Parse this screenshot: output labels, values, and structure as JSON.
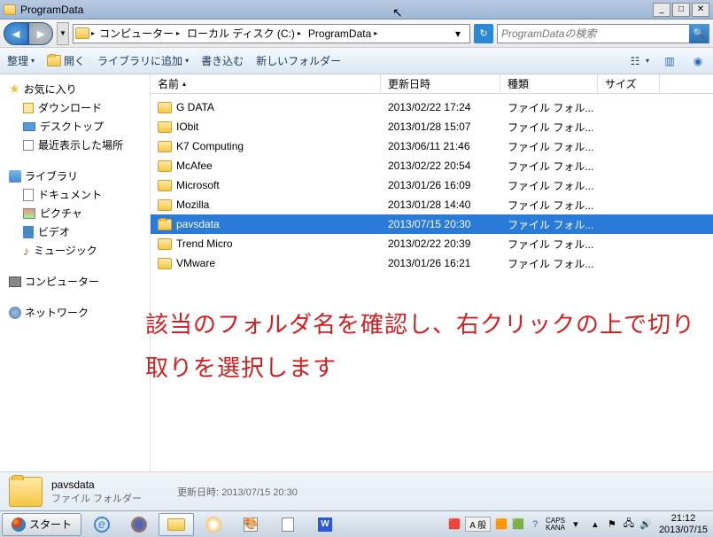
{
  "titlebar": {
    "title": "ProgramData"
  },
  "breadcrumb": {
    "items": [
      "コンピューター",
      "ローカル ディスク (C:)",
      "ProgramData"
    ]
  },
  "search": {
    "placeholder": "ProgramDataの検索"
  },
  "toolbar": {
    "organize": "整理",
    "open": "開く",
    "add_to_library": "ライブラリに追加",
    "burn": "書き込む",
    "new_folder": "新しいフォルダー"
  },
  "sidebar": {
    "favorites": {
      "label": "お気に入り",
      "items": [
        "ダウンロード",
        "デスクトップ",
        "最近表示した場所"
      ]
    },
    "libraries": {
      "label": "ライブラリ",
      "items": [
        "ドキュメント",
        "ピクチャ",
        "ビデオ",
        "ミュージック"
      ]
    },
    "computer": {
      "label": "コンピューター"
    },
    "network": {
      "label": "ネットワーク"
    }
  },
  "columns": {
    "name": "名前",
    "date": "更新日時",
    "type": "種類",
    "size": "サイズ"
  },
  "files": [
    {
      "name": "G DATA",
      "date": "2013/02/22 17:24",
      "type": "ファイル フォル..."
    },
    {
      "name": "IObit",
      "date": "2013/01/28 15:07",
      "type": "ファイル フォル..."
    },
    {
      "name": "K7 Computing",
      "date": "2013/06/11 21:46",
      "type": "ファイル フォル..."
    },
    {
      "name": "McAfee",
      "date": "2013/02/22 20:54",
      "type": "ファイル フォル..."
    },
    {
      "name": "Microsoft",
      "date": "2013/01/26 16:09",
      "type": "ファイル フォル..."
    },
    {
      "name": "Mozilla",
      "date": "2013/01/28 14:40",
      "type": "ファイル フォル..."
    },
    {
      "name": "pavsdata",
      "date": "2013/07/15 20:30",
      "type": "ファイル フォル...",
      "selected": true
    },
    {
      "name": "Trend Micro",
      "date": "2013/02/22 20:39",
      "type": "ファイル フォル..."
    },
    {
      "name": "VMware",
      "date": "2013/01/26 16:21",
      "type": "ファイル フォル..."
    }
  ],
  "annotation": "該当のフォルダ名を確認し、右クリックの上で切り取りを選択します",
  "details": {
    "name": "pavsdata",
    "type": "ファイル フォルダー",
    "date_label": "更新日時:",
    "date": "2013/07/15 20:30"
  },
  "taskbar": {
    "start": "スタート",
    "ime_a": "A 般",
    "ime_caps": "CAPS",
    "ime_kana": "KANA",
    "time": "21:12",
    "date": "2013/07/15"
  }
}
